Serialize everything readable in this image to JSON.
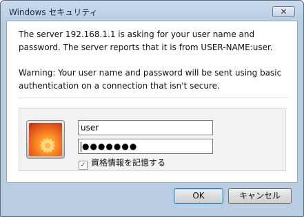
{
  "window": {
    "title": "Windows セキュリティ",
    "close_label": "✕"
  },
  "message": {
    "line1": "The server 192.168.1.1 is asking for your user name and password. The server reports that it is from USER-NAME:user.",
    "warning": "Warning: Your user name and password will be sent using basic authentication on a connection that isn't secure."
  },
  "credentials": {
    "username_value": "user",
    "password_masked": "●●●●●●●",
    "remember_label": "資格情報を記憶する",
    "remember_checked": true
  },
  "buttons": {
    "ok_label": "OK",
    "cancel_label": "キャンセル"
  },
  "icons": {
    "avatar": "user-avatar-icon",
    "checkbox_mark": "check-icon"
  }
}
